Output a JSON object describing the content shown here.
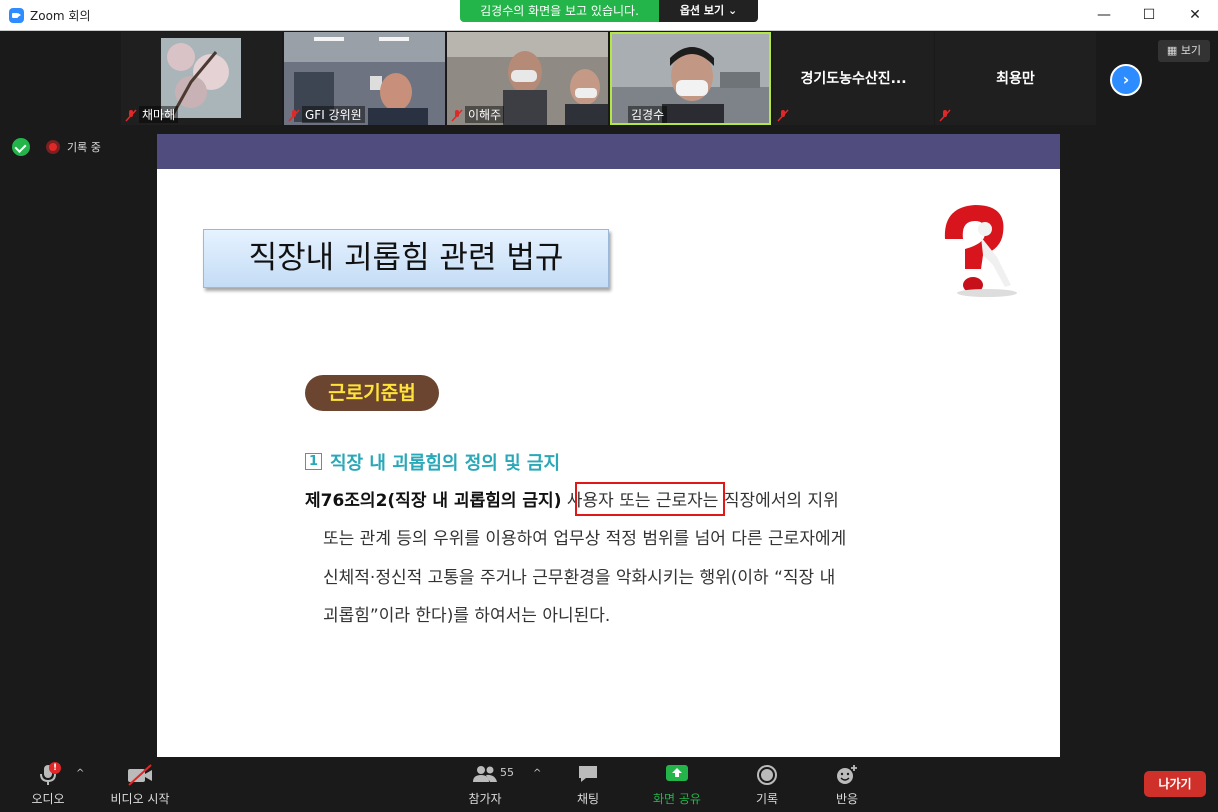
{
  "window": {
    "title": "Zoom 회의",
    "minimize_label": "—",
    "maximize_label": "☐",
    "close_label": "✕"
  },
  "banner": {
    "viewing_text": "김경수의 화면을 보고 있습니다.",
    "options_label": "옵션 보기 ⌄"
  },
  "participants_strip": [
    {
      "name": "채마해",
      "muted": true
    },
    {
      "name": "GFI 강위원",
      "muted": true
    },
    {
      "name": "이해주",
      "muted": true
    },
    {
      "name": "김경수",
      "muted": false,
      "speaking": true
    },
    {
      "name": "경기도농수산진...",
      "muted": true
    },
    {
      "name": "최용만",
      "muted": true
    }
  ],
  "view_label": "보기",
  "next_label": "›",
  "recording": {
    "text": "기록 중"
  },
  "slide": {
    "title": "직장내 괴롭힘 관련 법규",
    "law_badge": "근로기준법",
    "section_number": "1",
    "section_title": "직장 내 괴롭힘의 정의 및 금지",
    "line1_bold": "제76조의2(직장 내 괴롭힘의 금지)",
    "line1_rest": " 사용자 또는 근로자는 직장에서의 지위",
    "line2": "또는 관계 등의 우위를 이용하여 업무상 적정 범위를 넘어 다른 근로자에게",
    "line3": "신체적·정신적 고통을 주거나 근무환경을 악화시키는 행위(이하 “직장 내",
    "line4": "괴롭힘”이라 한다)를 하여서는 아니된다."
  },
  "toolbar": {
    "audio": "오디오",
    "video": "비디오 시작",
    "participants": "참가자",
    "participants_count": "55",
    "chat": "채팅",
    "share": "화면 공유",
    "record": "기록",
    "reactions": "반응",
    "leave": "나가기",
    "audio_badge": "!"
  },
  "colors": {
    "share_green": "#23b44a",
    "leave_red": "#d0302a",
    "slide_band": "#504d7e",
    "accent_blue": "#2d8cff"
  }
}
